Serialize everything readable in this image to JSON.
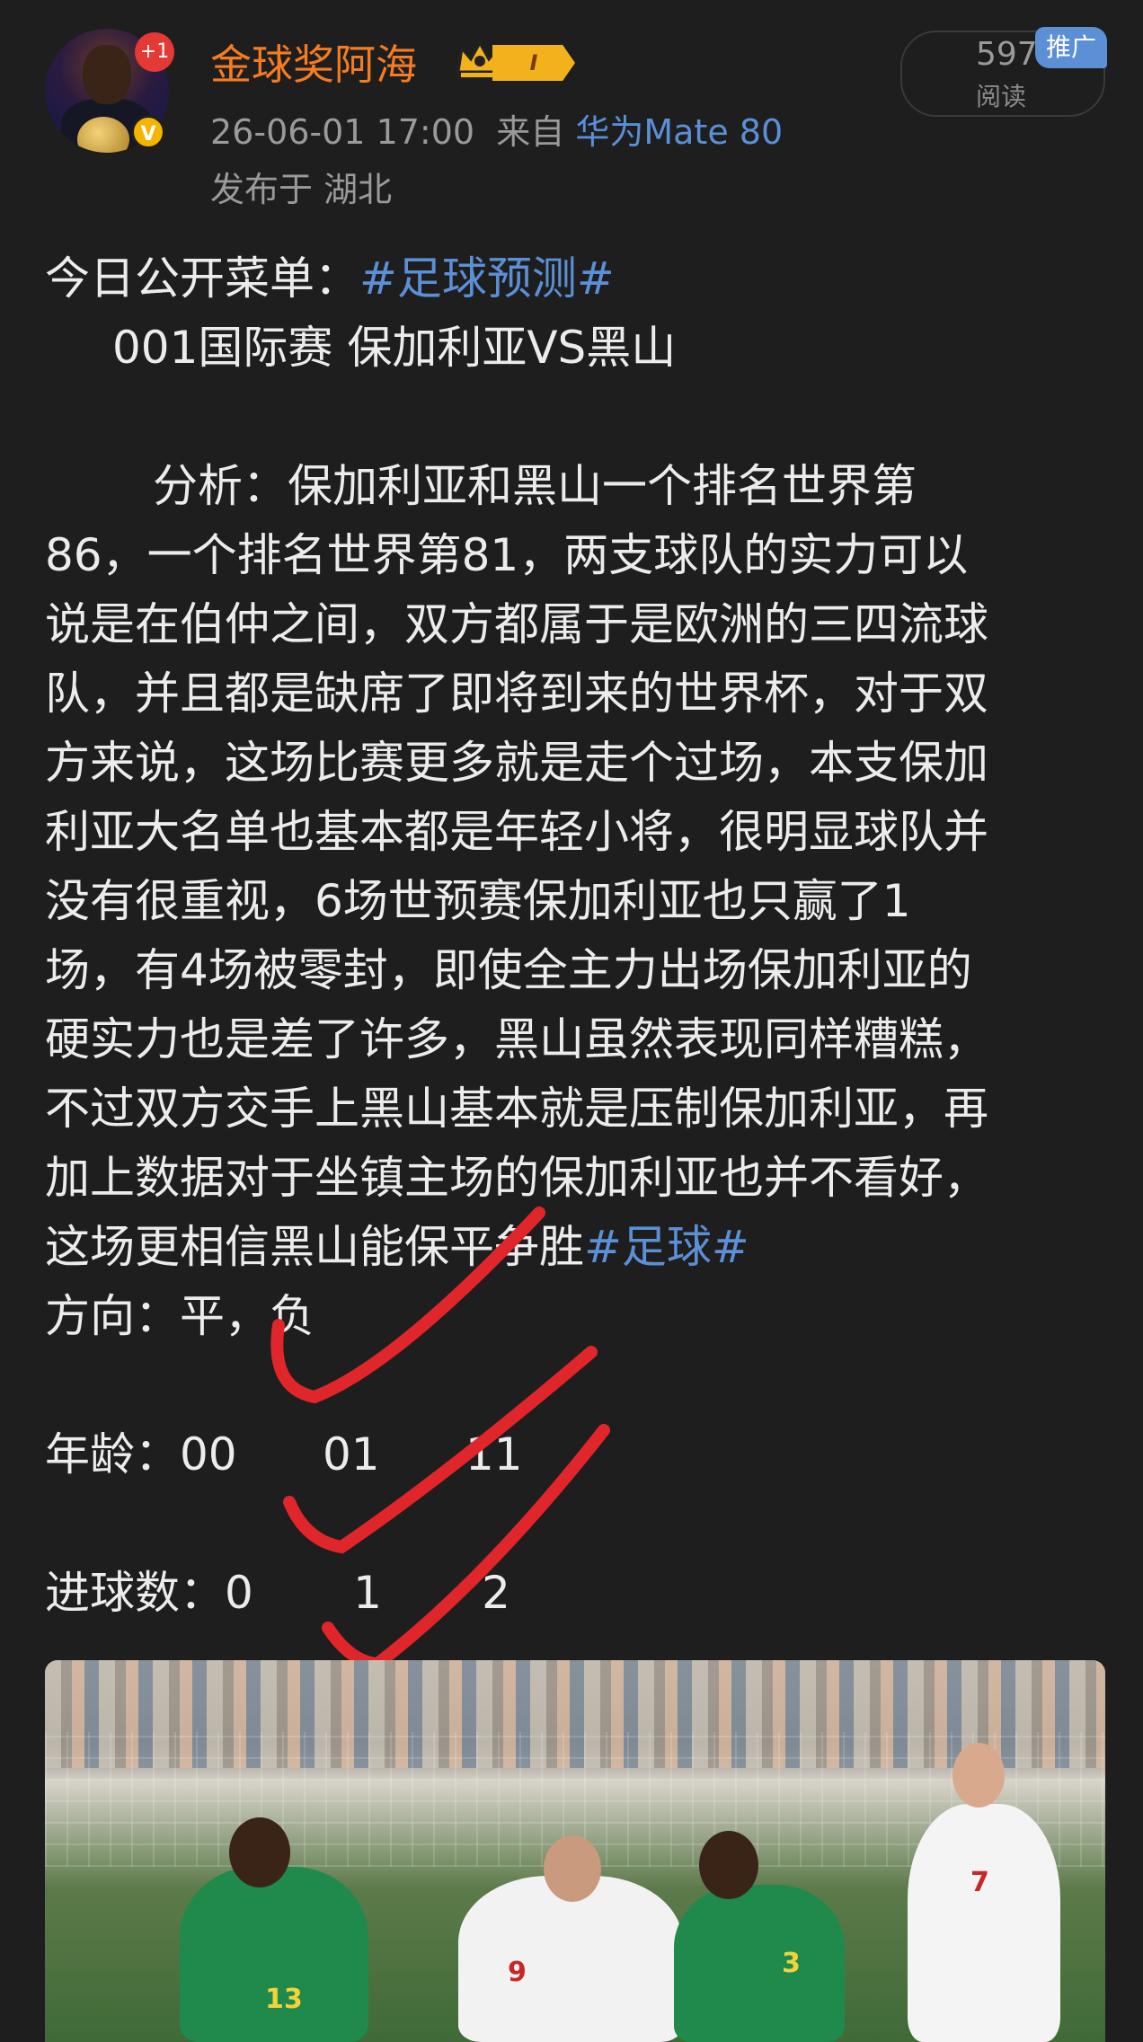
{
  "author": {
    "name": "金球奖阿海",
    "notif_badge": "+1",
    "level_badge": "I",
    "verified_mark": "V"
  },
  "meta": {
    "datetime": "26-06-01 17:00",
    "source_prefix": "来自",
    "device": "华为Mate 80",
    "location": "发布于  湖北"
  },
  "stats": {
    "read_count": "597",
    "read_label": "阅读",
    "promo_label": "推广"
  },
  "post": {
    "line1_text": "今日公开菜单：",
    "line1_tag": "#足球预测#",
    "line2": "001国际赛 保加利亚VS黑山",
    "analysis_lines": [
      "分析：保加利亚和黑山一个排名世界第",
      "86，一个排名世界第81，两支球队的实力可以",
      "说是在伯仲之间，双方都属于是欧洲的三四流球",
      "队，并且都是缺席了即将到来的世界杯，对于双",
      "方来说，这场比赛更多就是走个过场，本支保加",
      "利亚大名单也基本都是年轻小将，很明显球队并",
      "没有很重视，6场世预赛保加利亚也只赢了1",
      "场，有4场被零封，即使全主力出场保加利亚的",
      "硬实力也是差了许多，黑山虽然表现同样糟糕，",
      "不过双方交手上黑山基本就是压制保加利亚，再",
      "加上数据对于坐镇主场的保加利亚也并不看好，"
    ],
    "last_line_text": "这场更相信黑山能保平争胜",
    "last_line_tag": "#足球#",
    "direction": "方向：平，负",
    "age": "年龄：00      01      11",
    "goals": "进球数：0       1       2"
  },
  "colors": {
    "background": "#1e1e1e",
    "username": "#f57c22",
    "link": "#5b8fd6",
    "check_mark": "#e0262b"
  },
  "photo": {
    "jersey_numbers": [
      "13",
      "9",
      "3",
      "7"
    ]
  }
}
